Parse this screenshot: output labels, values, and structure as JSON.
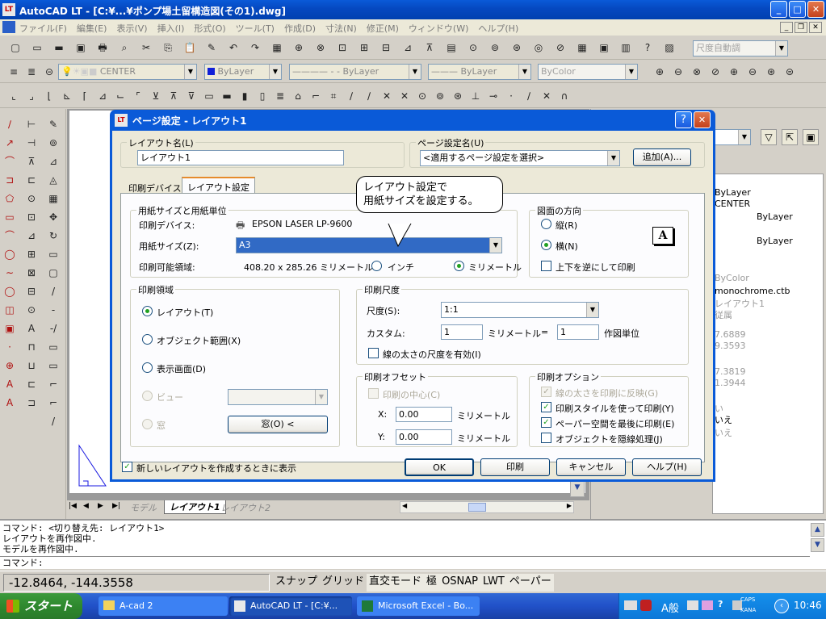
{
  "app": {
    "title": "AutoCAD LT - [C:¥...¥ポンプ場土留構造図(その1).dwg]",
    "menu": [
      "ファイル(F)",
      "編集(E)",
      "表示(V)",
      "挿入(I)",
      "形式(O)",
      "ツール(T)",
      "作成(D)",
      "寸法(N)",
      "修正(M)",
      "ウィンドウ(W)",
      "ヘルプ(H)"
    ],
    "dim_combo": "尺度自動調",
    "layer_combo": "CENTER",
    "color_combo": "ByLayer",
    "linetype_combo": "ByLayer",
    "lineweight_combo": "ByLayer",
    "plotstyle_combo": "ByColor"
  },
  "layout_tabs": {
    "model": "モデル",
    "layout1": "レイアウト1",
    "layout2": "レイアウト2"
  },
  "right_panel": {
    "items": [
      "ByLayer",
      "CENTER",
      "ByLayer",
      "ByLayer",
      "ByColor",
      "monochrome.ctb",
      "レイアウト1",
      "従属",
      "7.6889",
      "9.3593",
      "7.3819",
      "1.3944",
      "い",
      "いえ",
      "いえ"
    ]
  },
  "command": {
    "lines": [
      "コマンド:  <切り替え先: レイアウト1>",
      "レイアウトを再作図中.",
      "モデルを再作図中."
    ],
    "prompt": "コマンド:"
  },
  "status": {
    "coords": "-12.8464, -144.3558",
    "buttons": [
      "スナップ",
      "グリッド",
      "直交モード",
      "極",
      "OSNAP",
      "LWT",
      "ペーパー"
    ]
  },
  "taskbar": {
    "start": "スタート",
    "tasks": [
      "A-cad 2",
      "AutoCAD LT - [C:¥...",
      "Microsoft Excel - Bo..."
    ],
    "ime": "A般",
    "caps": "CAPS",
    "kana": "KANA",
    "clock": "10:46"
  },
  "dialog": {
    "title": "ページ設定 - レイアウト1",
    "layout_name_label": "レイアウト名(L)",
    "layout_name_value": "レイアウト1",
    "page_setup_label": "ページ設定名(U)",
    "page_setup_value": "<適用するページ設定を選択>",
    "add_button": "追加(A)...",
    "tabs": [
      "印刷デバイス",
      "レイアウト設定"
    ],
    "callout": {
      "line1": "レイアウト設定で",
      "line2": "用紙サイズを設定する。"
    },
    "paper_group": "用紙サイズと用紙単位",
    "device_label": "印刷デバイス:",
    "device_value": "EPSON LASER LP-9600",
    "paper_size_label": "用紙サイズ(Z):",
    "paper_size_value": "A3",
    "printable_label": "印刷可能領域:",
    "printable_value": "408.20 x 285.26 ミリメートル",
    "unit_inch": "インチ",
    "unit_mm": "ミリメートル",
    "orientation_group": "図面の方向",
    "portrait": "縦(R)",
    "landscape": "横(N)",
    "upside_down": "上下を逆にして印刷",
    "orientation_icon": "A",
    "plot_area_group": "印刷領域",
    "area_layout": "レイアウト(T)",
    "area_extents": "オブジェクト範囲(X)",
    "area_display": "表示画面(D)",
    "area_view": "ビュー",
    "area_window": "窓",
    "window_button": "窓(O) <",
    "scale_group": "印刷尺度",
    "scale_label": "尺度(S):",
    "scale_value": "1:1",
    "custom_label": "カスタム:",
    "custom_mm": "1",
    "custom_mm_unit": "ミリメートル",
    "equals": "=",
    "custom_units": "1",
    "custom_units_label": "作図単位",
    "scale_lineweights": "線の太さの尺度を有効(I)",
    "offset_group": "印刷オフセット",
    "center_plot": "印刷の中心(C)",
    "x_label": "X:",
    "x_value": "0.00",
    "x_unit": "ミリメートル",
    "y_label": "Y:",
    "y_value": "0.00",
    "y_unit": "ミリメートル",
    "options_group": "印刷オプション",
    "opt_lineweights": "線の太さを印刷に反映(G)",
    "opt_plotstyles": "印刷スタイルを使って印刷(Y)",
    "opt_paperspace_last": "ペーパー空間を最後に印刷(E)",
    "opt_hide": "オブジェクトを隠線処理(J)",
    "new_layout_check": "新しいレイアウトを作成するときに表示",
    "ok": "OK",
    "plot": "印刷",
    "cancel": "キャンセル",
    "help": "ヘルプ(H)"
  }
}
